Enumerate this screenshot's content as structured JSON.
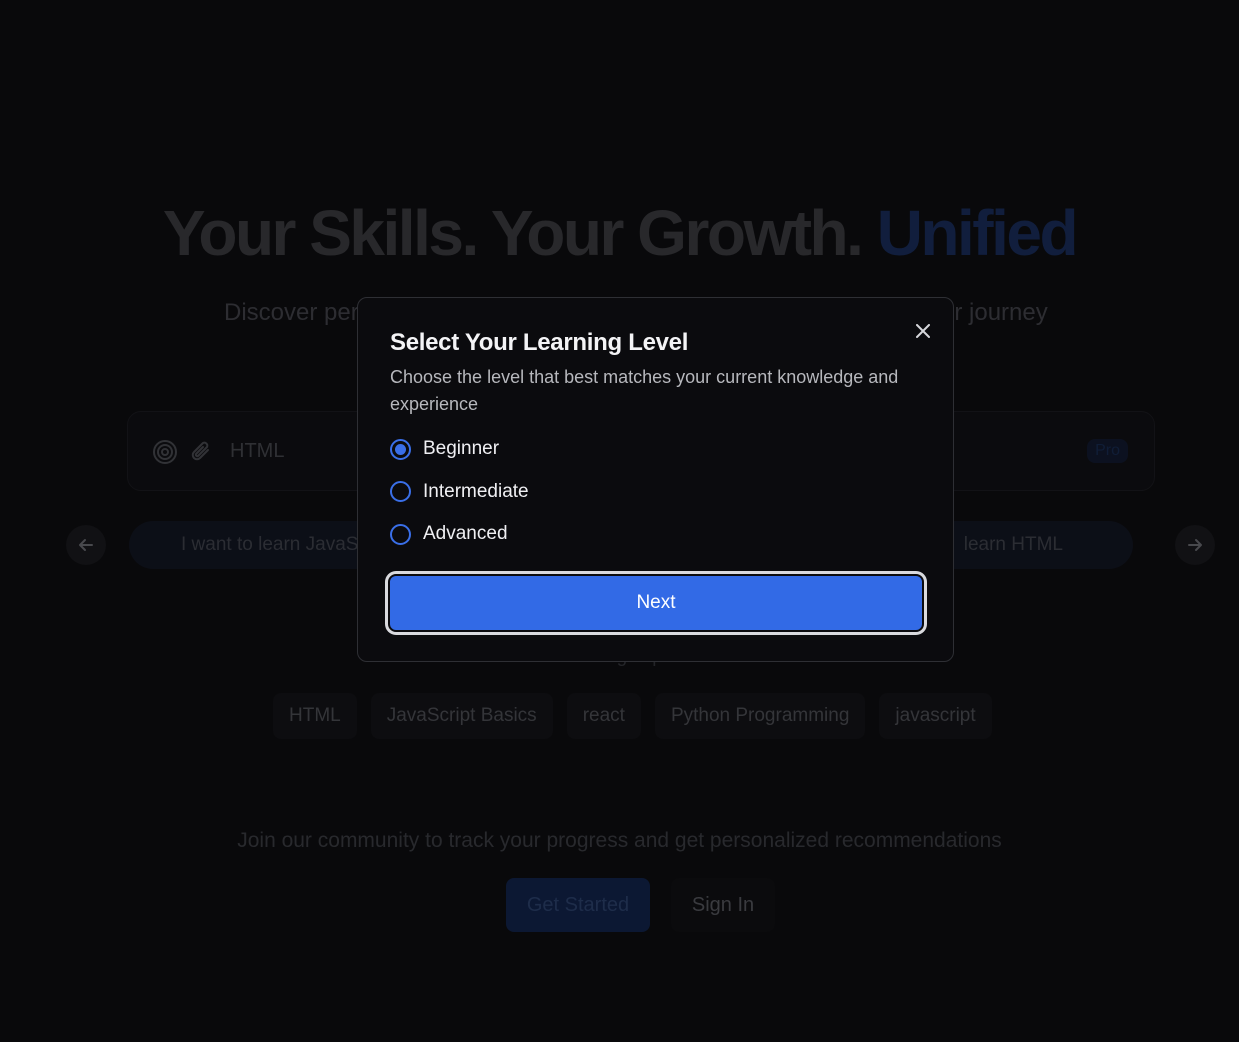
{
  "hero": {
    "title_main": "Your Skills. Your Growth.",
    "title_accent": "Unified",
    "subtitle_left": "Discover per",
    "subtitle_right": "ur journey"
  },
  "search": {
    "value": "HTML",
    "pro_badge": "Pro",
    "icons": [
      "target-icon",
      "paperclip-icon"
    ]
  },
  "suggestions": {
    "items": [
      "I want to learn JavaS",
      "learn HTML"
    ]
  },
  "trending": {
    "label": "Trending Topics",
    "topics": [
      "HTML",
      "JavaScript Basics",
      "react",
      "Python Programming",
      "javascript"
    ]
  },
  "community": {
    "text": "Join our community to track your progress and get personalized recommendations",
    "get_started": "Get Started",
    "sign_in": "Sign In"
  },
  "modal": {
    "title": "Select Your Learning Level",
    "description": "Choose the level that best matches your current knowledge and experience",
    "options": [
      {
        "label": "Beginner",
        "selected": true
      },
      {
        "label": "Intermediate",
        "selected": false
      },
      {
        "label": "Advanced",
        "selected": false
      }
    ],
    "next_label": "Next"
  },
  "colors": {
    "accent": "#326ae6",
    "background": "#0b0b0d"
  }
}
